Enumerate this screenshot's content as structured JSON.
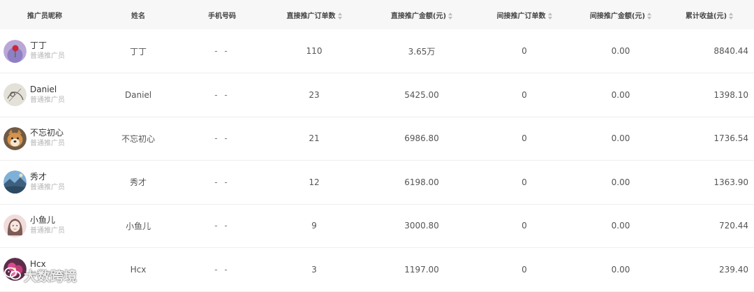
{
  "table": {
    "headers": [
      {
        "label": "推广员昵称",
        "sortable": false
      },
      {
        "label": "姓名",
        "sortable": false
      },
      {
        "label": "手机号码",
        "sortable": false
      },
      {
        "label": "直接推广订单数",
        "sortable": true
      },
      {
        "label": "直接推广金额(元)",
        "sortable": true
      },
      {
        "label": "间接推广订单数",
        "sortable": true
      },
      {
        "label": "间接推广金额(元)",
        "sortable": true
      },
      {
        "label": "累计收益(元)",
        "sortable": true
      }
    ],
    "rows": [
      {
        "nickname": "丁丁",
        "role": "普通推广员",
        "name": "丁丁",
        "phone": "- -",
        "direct_orders": "110",
        "direct_amount": "3.65万",
        "indirect_orders": "0",
        "indirect_amount": "0.00",
        "total_income": "8840.44",
        "avatar_icon": "flower-avatar-icon"
      },
      {
        "nickname": "Daniel",
        "role": "普通推广员",
        "name": "Daniel",
        "phone": "- -",
        "direct_orders": "23",
        "direct_amount": "5425.00",
        "indirect_orders": "0",
        "indirect_amount": "0.00",
        "total_income": "1398.10",
        "avatar_icon": "sketch-avatar-icon"
      },
      {
        "nickname": "不忘初心",
        "role": "普通推广员",
        "name": "不忘初心",
        "phone": "- -",
        "direct_orders": "21",
        "direct_amount": "6986.80",
        "indirect_orders": "0",
        "indirect_amount": "0.00",
        "total_income": "1736.54",
        "avatar_icon": "dog-avatar-icon"
      },
      {
        "nickname": "秀才",
        "role": "普通推广员",
        "name": "秀才",
        "phone": "- -",
        "direct_orders": "12",
        "direct_amount": "6198.00",
        "indirect_orders": "0",
        "indirect_amount": "0.00",
        "total_income": "1363.90",
        "avatar_icon": "landscape-avatar-icon"
      },
      {
        "nickname": "小鱼儿",
        "role": "普通推广员",
        "name": "小鱼儿",
        "phone": "- -",
        "direct_orders": "9",
        "direct_amount": "3000.80",
        "indirect_orders": "0",
        "indirect_amount": "0.00",
        "total_income": "720.44",
        "avatar_icon": "girl-avatar-icon"
      },
      {
        "nickname": "Hcx",
        "role": "普通推广员",
        "name": "Hcx",
        "phone": "- -",
        "direct_orders": "3",
        "direct_amount": "1197.00",
        "indirect_orders": "0",
        "indirect_amount": "0.00",
        "total_income": "239.40",
        "avatar_icon": "pink-flower-avatar-icon"
      }
    ]
  },
  "watermark": {
    "text": "大数跨境",
    "icon": "wechat-icon"
  },
  "colors": {
    "header_bg": "#f7f7f7",
    "row_border": "#eeeeee",
    "text": "#555555",
    "muted": "#b5b5b5"
  }
}
